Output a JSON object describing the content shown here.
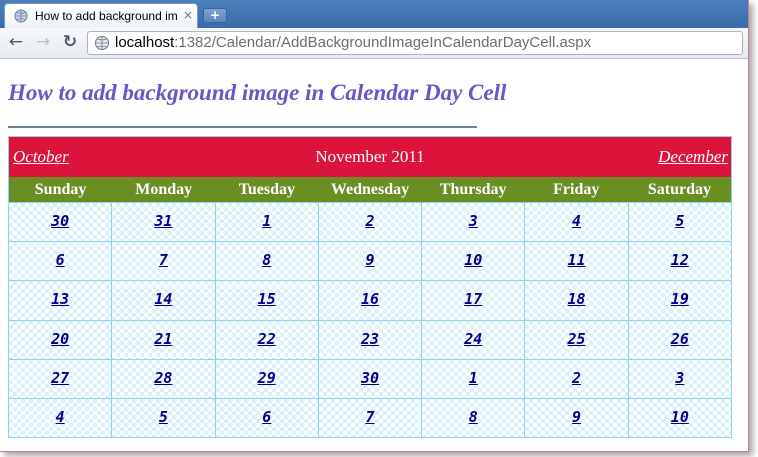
{
  "browser": {
    "tab_title": "How to add background im",
    "tab_close": "×",
    "new_tab": "+",
    "back_icon": "←",
    "forward_icon": "→",
    "reload_icon": "↻",
    "url_host": "localhost",
    "url_rest": ":1382/Calendar/AddBackgroundImageInCalendarDayCell.aspx"
  },
  "page": {
    "title": "How to add background image in Calendar Day Cell"
  },
  "calendar": {
    "prev_label": "October",
    "next_label": "December",
    "month_title": "November 2011",
    "days_of_week": [
      "Sunday",
      "Monday",
      "Tuesday",
      "Wednesday",
      "Thursday",
      "Friday",
      "Saturday"
    ],
    "weeks": [
      [
        "30",
        "31",
        "1",
        "2",
        "3",
        "4",
        "5"
      ],
      [
        "6",
        "7",
        "8",
        "9",
        "10",
        "11",
        "12"
      ],
      [
        "13",
        "14",
        "15",
        "16",
        "17",
        "18",
        "19"
      ],
      [
        "20",
        "21",
        "22",
        "23",
        "24",
        "25",
        "26"
      ],
      [
        "27",
        "28",
        "29",
        "30",
        "1",
        "2",
        "3"
      ],
      [
        "4",
        "5",
        "6",
        "7",
        "8",
        "9",
        "10"
      ]
    ]
  },
  "colors": {
    "header_bg": "#dc143c",
    "dow_bg": "#6b8e23",
    "day_text": "#00008b",
    "title_text": "#6b54c9",
    "cell_border": "#8fd3ea"
  }
}
